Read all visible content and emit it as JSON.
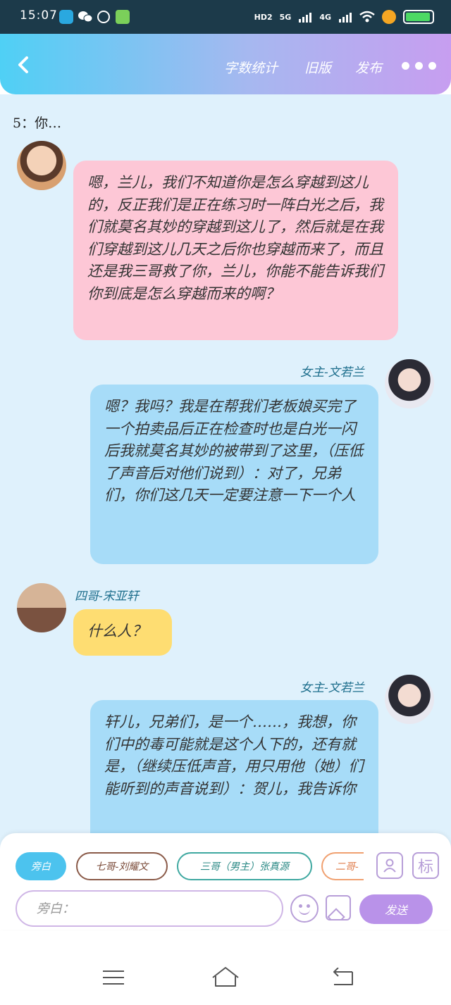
{
  "status_bar": {
    "time": "15:07",
    "network_labels": [
      "HD2",
      "5G",
      "4G"
    ],
    "battery_label": "11"
  },
  "header": {
    "word_stats": "字数统计",
    "old_version": "旧版",
    "publish": "发布"
  },
  "chat": {
    "preview": "5：你…",
    "messages": [
      {
        "side": "left",
        "name": "",
        "text": "嗯，兰儿，我们不知道你是怎么穿越到这儿的，反正我们是正在练习时一阵白光之后，我们就莫名其妙的穿越到这儿了，然后就是在我们穿越到这儿几天之后你也穿越而来了，而且还是我三哥救了你，兰儿，你能不能告诉我们你到底是怎么穿越而来的啊？"
      },
      {
        "side": "right",
        "name": "女主-文若兰",
        "text": "嗯？我吗？我是在帮我们老板娘买完了一个拍卖品后正在检查时也是白光一闪后我就莫名其妙的被带到了这里，（压低了声音后对他们说到）：对了，兄弟们，你们这几天一定要注意一下一个人"
      },
      {
        "side": "left",
        "name": "四哥-宋亚轩",
        "text": "什么人？"
      },
      {
        "side": "right",
        "name": "女主-文若兰",
        "text": "轩儿，兄弟们，是一个……，我想，你们中的毒可能就是这个人下的，还有就是，（继续压低声音，用只用他（她）们能听到的声音说到）：贺儿，我告诉你"
      }
    ]
  },
  "input_panel": {
    "roles": [
      "旁白",
      "七哥-刘耀文",
      "三哥（男主）张真源",
      "二哥-"
    ],
    "mark_button": "标",
    "placeholder": "旁白：",
    "send_label": "发送"
  }
}
